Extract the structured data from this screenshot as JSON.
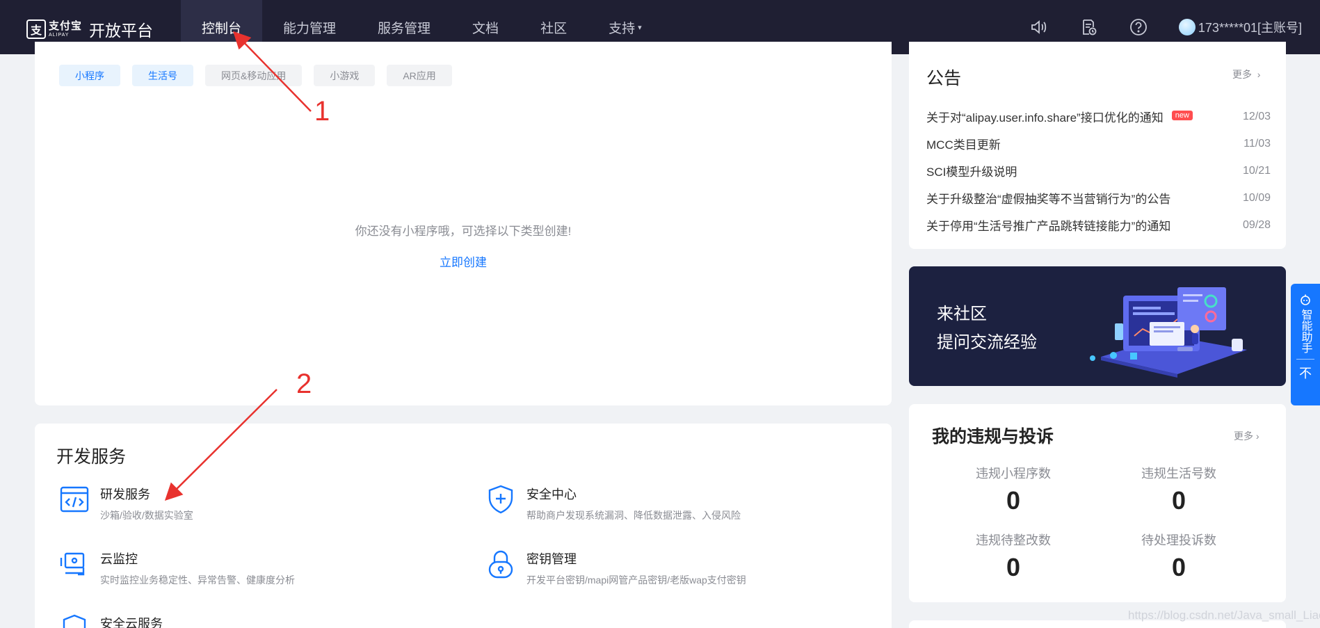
{
  "header": {
    "logo_cn": "支付宝",
    "logo_en": "ALIPAY",
    "platform_name": "开放平台",
    "nav": [
      {
        "label": "控制台",
        "active": true
      },
      {
        "label": "能力管理"
      },
      {
        "label": "服务管理"
      },
      {
        "label": "文档"
      },
      {
        "label": "社区"
      },
      {
        "label": "支持",
        "has_dropdown": true
      }
    ],
    "icons": [
      "speaker-icon",
      "document-clock-icon",
      "help-icon"
    ],
    "user_account": "173*****01[主账号]"
  },
  "apps": {
    "tabs": [
      "小程序",
      "生活号",
      "网页&移动应用",
      "小游戏",
      "AR应用"
    ],
    "active_tab": "小程序",
    "empty_message": "你还没有小程序哦，可选择以下类型创建!",
    "create_link": "立即创建"
  },
  "dev_services": {
    "title": "开发服务",
    "items": [
      {
        "icon": "code-window-icon",
        "name": "研发服务",
        "desc": "沙箱/验收/数据实验室"
      },
      {
        "icon": "shield-plus-icon",
        "name": "安全中心",
        "desc": "帮助商户发现系统漏洞、降低数据泄露、入侵风险"
      },
      {
        "icon": "monitor-icon",
        "name": "云监控",
        "desc": "实时监控业务稳定性、异常告警、健康度分析"
      },
      {
        "icon": "lock-icon",
        "name": "密钥管理",
        "desc": "开发平台密钥/mapi网管产品密钥/老版wap支付密钥"
      },
      {
        "icon": "cloud-shield-icon",
        "name": "安全云服务",
        "desc": ""
      }
    ]
  },
  "notice": {
    "title": "公告",
    "more": "更多",
    "items": [
      {
        "text": "关于对“alipay.user.info.share”接口优化的通知",
        "date": "12/03",
        "badge": "new"
      },
      {
        "text": "MCC类目更新",
        "date": "11/03"
      },
      {
        "text": "SCI模型升级说明",
        "date": "10/21"
      },
      {
        "text": "关于升级整治“虚假抽奖等不当营销行为”的公告",
        "date": "10/09"
      },
      {
        "text": "关于停用“生活号推广产品跳转链接能力”的通知",
        "date": "09/28"
      }
    ]
  },
  "community": {
    "line1": "来社区",
    "line2": "提问交流经验"
  },
  "violations": {
    "title": "我的违规与投诉",
    "more": "更多",
    "stats": [
      {
        "label": "违规小程序数",
        "value": "0"
      },
      {
        "label": "违规生活号数",
        "value": "0"
      },
      {
        "label": "违规待整改数",
        "value": "0"
      },
      {
        "label": "待处理投诉数",
        "value": "0"
      }
    ]
  },
  "assistant": {
    "label": "智能助手",
    "close": "不"
  },
  "annotations": {
    "label_1": "1",
    "label_2": "2",
    "arrow_color": "#e8322e"
  },
  "watermark": "https://blog.csdn.net/Java_small_Liao",
  "colors": {
    "topbar": "#1f1f33",
    "accent": "#1677ff",
    "badge": "#ff4d4f"
  }
}
